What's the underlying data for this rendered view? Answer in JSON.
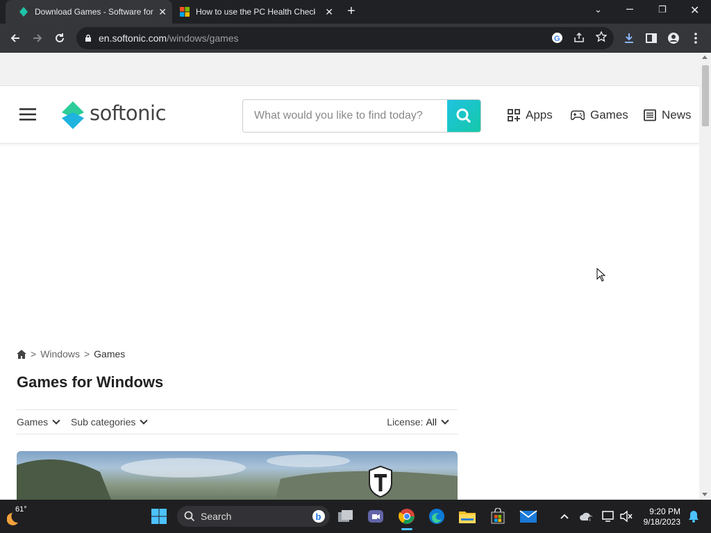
{
  "browser": {
    "tabs": [
      {
        "title": "Download Games - Software for",
        "active": true
      },
      {
        "title": "How to use the PC Health Check",
        "active": false
      }
    ],
    "new_tab_label": "+",
    "url_host": "en.softonic.com",
    "url_path": "/windows/games"
  },
  "site": {
    "logo_text": "softonic",
    "search_placeholder": "What would you like to find today?",
    "nav": [
      {
        "label": "Apps"
      },
      {
        "label": "Games"
      },
      {
        "label": "News"
      }
    ]
  },
  "breadcrumb": {
    "home_icon": "home-icon",
    "sep": ">",
    "level1": "Windows",
    "level2": "Games"
  },
  "page": {
    "title": "Games for Windows",
    "filters": {
      "games": "Games",
      "subcategories": "Sub categories",
      "license_label": "License:",
      "license_value": "All"
    }
  },
  "taskbar": {
    "weather_temp": "61°",
    "search_label": "Search",
    "time": "9:20 PM",
    "date": "9/18/2023"
  },
  "colors": {
    "brand_gradient_start": "#1fc3e0",
    "brand_gradient_end": "#15c8a8",
    "browser_dark": "#202124"
  }
}
